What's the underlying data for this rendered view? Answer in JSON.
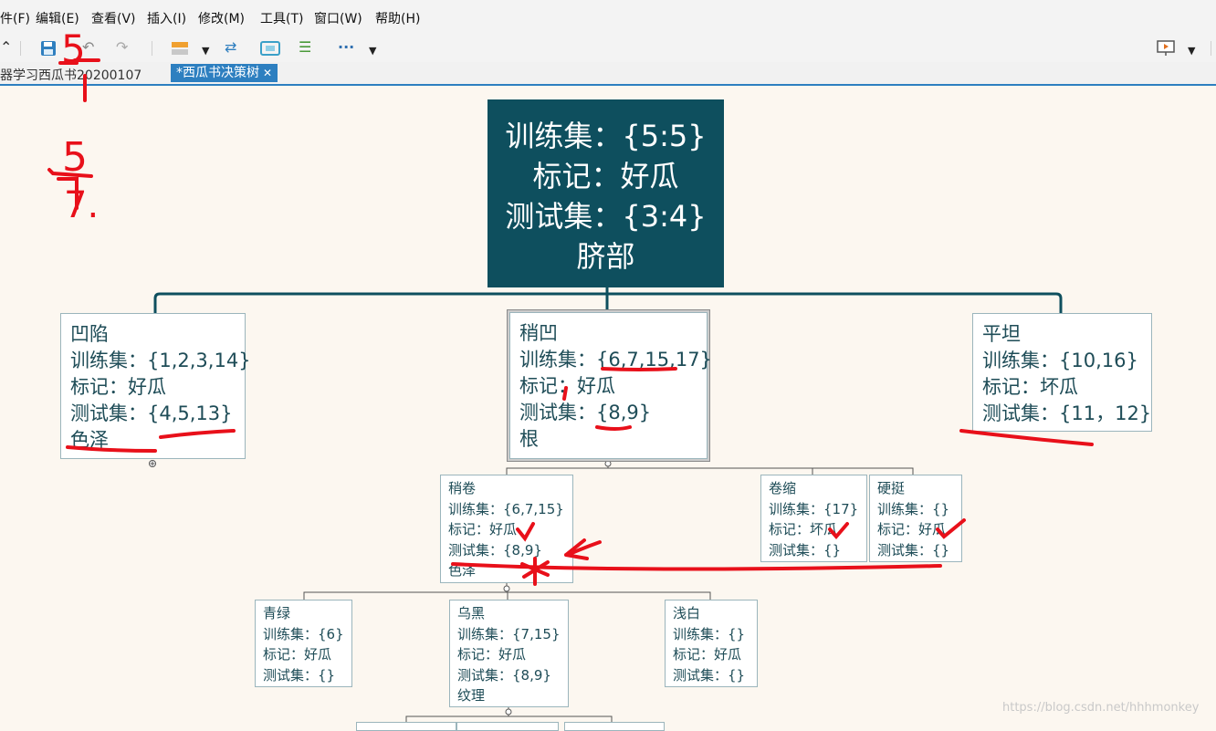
{
  "menu": [
    "件(F)",
    "编辑(E)",
    "查看(V)",
    "插入(I)",
    "修改(M)",
    "工具(T)",
    "窗口(W)",
    "帮助(H)"
  ],
  "tabs": [
    "器学习西瓜书20200107",
    "*西瓜书决策树"
  ],
  "root": {
    "lines": [
      "训练集：{5:5}",
      "标记：好瓜",
      "测试集：{3:4}",
      "脐部"
    ]
  },
  "level1": [
    {
      "lines": [
        "凹陷",
        "训练集：{1,2,3,14}",
        "标记：好瓜",
        "测试集：{4,5,13}",
        "色泽"
      ]
    },
    {
      "lines": [
        "稍凹",
        "训练集：{6,7,15,17}",
        "标记：好瓜",
        "测试集：{8,9}",
        "根"
      ]
    },
    {
      "lines": [
        "平坦",
        "训练集：{10,16}",
        "标记：坏瓜",
        "测试集：{11，12}"
      ]
    }
  ],
  "level2": [
    {
      "lines": [
        "稍卷",
        "训练集：{6,7,15}",
        "标记：好瓜",
        "测试集：{8,9}",
        "色泽"
      ]
    },
    {
      "lines": [
        "卷缩",
        "训练集：{17}",
        "标记：坏瓜",
        "测试集：{}"
      ]
    },
    {
      "lines": [
        "硬挺",
        "训练集：{}",
        "标记：好瓜",
        "测试集：{}"
      ]
    }
  ],
  "level3": [
    {
      "lines": [
        "青绿",
        "训练集：{6}",
        "标记：好瓜",
        "测试集：{}"
      ]
    },
    {
      "lines": [
        "乌黑",
        "训练集：{7,15}",
        "标记：好瓜",
        "测试集：{8,9}",
        "纹理"
      ]
    },
    {
      "lines": [
        "浅白",
        "训练集：{}",
        "标记：好瓜",
        "测试集：{}"
      ]
    }
  ],
  "annotations": [
    "5",
    "5",
    "7."
  ],
  "watermark": "https://blog.csdn.net/hhhmonkey",
  "colors": {
    "root_bg": "#0e4f5e",
    "node_text": "#1e4c57",
    "ink": "#e8101a",
    "tab_active": "#2d7fc0"
  }
}
